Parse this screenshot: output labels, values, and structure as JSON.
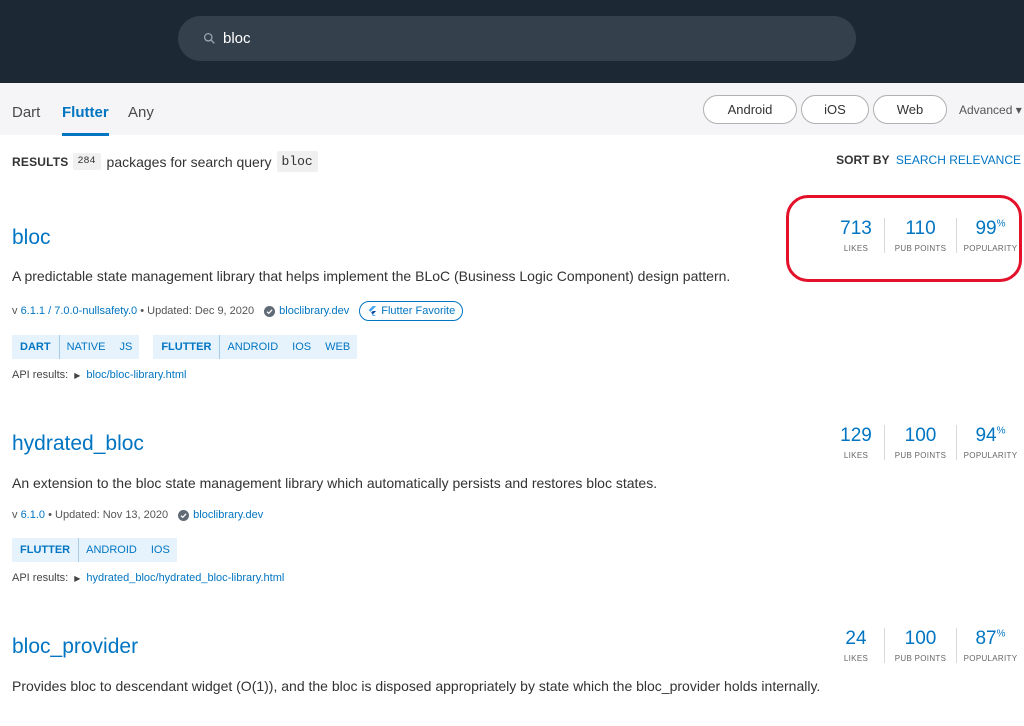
{
  "search": {
    "query": "bloc"
  },
  "filters": {
    "sdk_tabs": [
      "Dart",
      "Flutter",
      "Any"
    ],
    "platforms": [
      "Android",
      "iOS",
      "Web"
    ],
    "advanced": "Advanced ▾"
  },
  "results": {
    "label": "RESULTS",
    "count": "284",
    "text": "packages for search query",
    "query": "bloc",
    "sort_label": "SORT BY",
    "sort_value": "SEARCH RELEVANCE"
  },
  "stat_labels": {
    "likes": "LIKES",
    "points": "PUB POINTS",
    "popularity": "POPULARITY"
  },
  "packages": [
    {
      "name": "bloc",
      "description": "A predictable state management library that helps implement the BLoC (Business Logic Component) design pattern.",
      "version_prefix": "v",
      "version": "6.1.1 / 7.0.0-nullsafety.0",
      "updated": "• Updated: Dec 9, 2020",
      "publisher": "bloclibrary.dev",
      "favorite": "Flutter Favorite",
      "tag_groups": [
        {
          "head": "DART",
          "tags": [
            "NATIVE",
            "JS"
          ]
        },
        {
          "head": "FLUTTER",
          "tags": [
            "ANDROID",
            "IOS",
            "WEB"
          ]
        }
      ],
      "api_label": "API results:",
      "api_link": "bloc/bloc-library.html",
      "likes": "713",
      "points": "110",
      "popularity": "99"
    },
    {
      "name": "hydrated_bloc",
      "description": "An extension to the bloc state management library which automatically persists and restores bloc states.",
      "version_prefix": "v",
      "version": "6.1.0",
      "updated": "• Updated: Nov 13, 2020",
      "publisher": "bloclibrary.dev",
      "tag_groups": [
        {
          "head": "FLUTTER",
          "tags": [
            "ANDROID",
            "IOS"
          ]
        }
      ],
      "api_label": "API results:",
      "api_link": "hydrated_bloc/hydrated_bloc-library.html",
      "likes": "129",
      "points": "100",
      "popularity": "94"
    },
    {
      "name": "bloc_provider",
      "description": "Provides bloc to descendant widget (O(1)), and the bloc is disposed appropriately by state which the bloc_provider holds internally.",
      "likes": "24",
      "points": "100",
      "popularity": "87"
    }
  ],
  "percent_sign": "%",
  "colors": {
    "header": "#1c2834",
    "accent": "#0175c2",
    "highlight": "#e3112a"
  }
}
